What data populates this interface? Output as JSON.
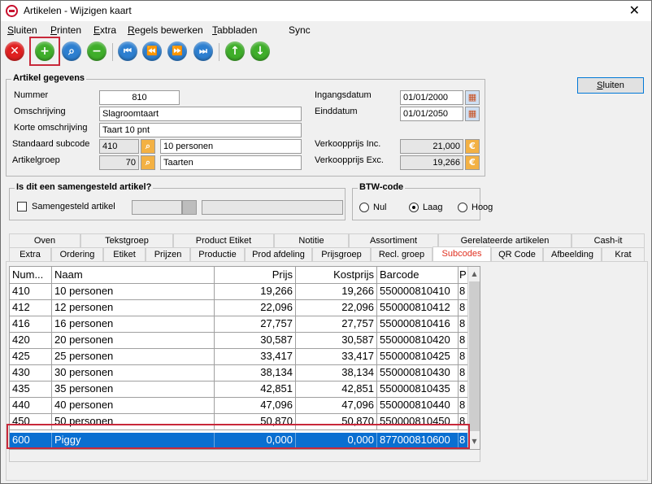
{
  "window": {
    "title": "Artikelen - Wijzigen kaart",
    "close_glyph": "✕"
  },
  "menu": [
    {
      "u": "S",
      "rest": "luiten"
    },
    {
      "u": "P",
      "rest": "rinten"
    },
    {
      "u": "E",
      "rest": "xtra"
    },
    {
      "u": "R",
      "rest": "egels bewerken"
    },
    {
      "u": "T",
      "rest": "abbladen"
    },
    {
      "u": "",
      "rest": "Sync"
    }
  ],
  "toolbar": {
    "icons": [
      "close-icon",
      "add-icon",
      "search-icon",
      "remove-icon",
      "first-icon",
      "previous-icon",
      "next-icon",
      "last-icon",
      "up-icon",
      "down-icon"
    ],
    "glyphs": {
      "close": "✕",
      "add": "+",
      "search": "⌕",
      "remove": "−",
      "first": "⏮",
      "previous": "⏪",
      "next": "⏩",
      "last": "⏭",
      "up": "↑",
      "down": "↓"
    },
    "colors": {
      "red": "#e02020",
      "green": "#3fae2a",
      "blue": "#2d7fd0",
      "highlight": "#c8283a"
    }
  },
  "sluiten_button": {
    "u": "S",
    "rest": "luiten"
  },
  "artikel": {
    "group_label": "Artikel gegevens",
    "nummer_label": "Nummer",
    "nummer": "810",
    "omschrijving_label": "Omschrijving",
    "omschrijving": "Slagroomtaart",
    "korte_label": "Korte omschrijving",
    "korte": "Taart 10 pnt",
    "subcode_label": "Standaard subcode",
    "subcode": "410",
    "subcode_desc": "10 personen",
    "groep_label": "Artikelgroep",
    "groep": "70",
    "groep_desc": "Taarten",
    "ingang_label": "Ingangsdatum",
    "ingang": "01/01/2000",
    "eind_label": "Einddatum",
    "eind": "01/01/2050",
    "vpinc_label": "Verkoopprijs Inc.",
    "vpinc": "21,000",
    "vpexc_label": "Verkoopprijs Exc.",
    "vpexc": "19,266",
    "euro": "€"
  },
  "samengesteld": {
    "group_label": "Is dit een samengesteld artikel?",
    "checkbox_label": "Samengesteld artikel"
  },
  "btw": {
    "group_label": "BTW-code",
    "options": [
      "Nul",
      "Laag",
      "Hoog"
    ],
    "selected": "Laag"
  },
  "tabs_row1": [
    "Oven",
    "Tekstgroep",
    "Product Etiket",
    "Notitie",
    "Assortiment",
    "Gerelateerde artikelen",
    "Cash-it"
  ],
  "tabs_row2": [
    "Extra",
    "Ordering",
    "Etiket",
    "Prijzen",
    "Productie",
    "Prod afdeling",
    "Prijsgroep",
    "Recl. groep",
    "Subcodes",
    "QR Code",
    "Afbeelding",
    "Krat"
  ],
  "active_tab": "Subcodes",
  "grid": {
    "headers": [
      "Num...",
      "Naam",
      "Prijs",
      "Kostprijs",
      "Barcode",
      "P"
    ],
    "rows": [
      [
        "410",
        "10 personen",
        "19,266",
        "19,266",
        "550000810410",
        "8"
      ],
      [
        "412",
        "12 personen",
        "22,096",
        "22,096",
        "550000810412",
        "8"
      ],
      [
        "416",
        "16 personen",
        "27,757",
        "27,757",
        "550000810416",
        "8"
      ],
      [
        "420",
        "20 personen",
        "30,587",
        "30,587",
        "550000810420",
        "8"
      ],
      [
        "425",
        "25 personen",
        "33,417",
        "33,417",
        "550000810425",
        "8"
      ],
      [
        "430",
        "30 personen",
        "38,134",
        "38,134",
        "550000810430",
        "8"
      ],
      [
        "435",
        "35 personen",
        "42,851",
        "42,851",
        "550000810435",
        "8"
      ],
      [
        "440",
        "40 personen",
        "47,096",
        "47,096",
        "550000810440",
        "8"
      ],
      [
        "450",
        "50 personen",
        "50,870",
        "50,870",
        "550000810450",
        "8"
      ],
      [
        "600",
        "Piggy",
        "0,000",
        "0,000",
        "877000810600",
        "8"
      ]
    ],
    "selected_row": 9,
    "scroll_up": "▲",
    "scroll_down": "▼"
  }
}
